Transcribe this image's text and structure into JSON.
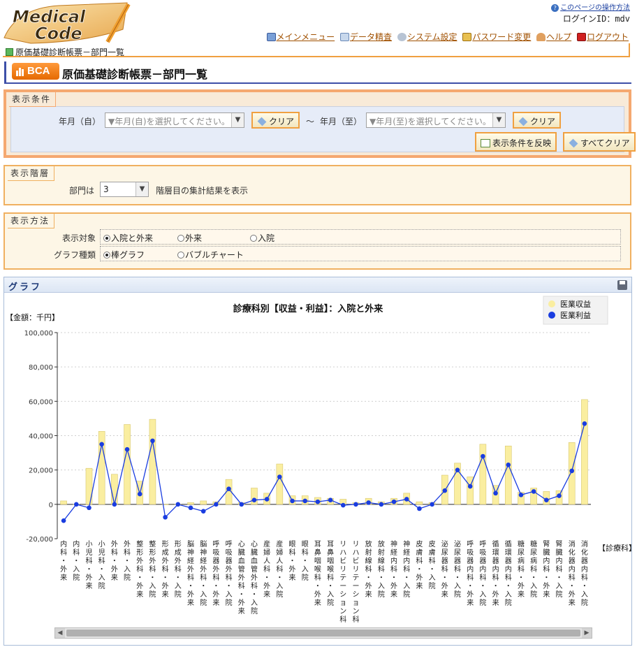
{
  "logo": {
    "line1": "Medical",
    "line2": "Code"
  },
  "header": {
    "help_link": "このページの操作方法",
    "login": "ログインID：mdv",
    "menu": [
      {
        "label": "メインメニュー",
        "icon": "menu-icon"
      },
      {
        "label": "データ精査",
        "icon": "data-icon"
      },
      {
        "label": "システム設定",
        "icon": "settings-icon"
      },
      {
        "label": "パスワード変更",
        "icon": "lock-icon"
      },
      {
        "label": "ヘルプ",
        "icon": "help-person-icon"
      },
      {
        "label": "ログアウト",
        "icon": "logout-icon"
      }
    ],
    "breadcrumb": "原価基礎診断帳票－部門一覧"
  },
  "title": {
    "badge": "BCA",
    "text": "原価基礎診断帳票－部門一覧"
  },
  "conditions": {
    "legend": "表示条件",
    "from_label": "年月（自）",
    "from_placeholder": "▼年月(自)を選択してください。",
    "clear1": "クリア",
    "tilde": "～",
    "to_label": "年月（至）",
    "to_placeholder": "▼年月(至)を選択してください。",
    "clear2": "クリア",
    "apply": "表示条件を反映",
    "clear_all": "すべてクリア"
  },
  "layer": {
    "legend": "表示階層",
    "prefix": "部門は",
    "value": "3",
    "suffix": "階層目の集計結果を表示"
  },
  "method": {
    "legend": "表示方法",
    "target_label": "表示対象",
    "targets": [
      "入院と外来",
      "外来",
      "入院"
    ],
    "target_selected": 0,
    "type_label": "グラフ種類",
    "types": [
      "棒グラフ",
      "バブルチャート"
    ],
    "type_selected": 0
  },
  "graph": {
    "header": "グラフ"
  },
  "chart_data": {
    "type": "bar",
    "title": "診療科別【収益・利益】：入院と外来",
    "ylabel": "【金額：千円】",
    "xlabel": "【診療科】",
    "ylim": [
      -20000,
      100000
    ],
    "yticks": [
      "100,000",
      "80,000",
      "60,000",
      "40,000",
      "20,000",
      "0",
      "-20,000"
    ],
    "grid": true,
    "legend_position": "top-right",
    "categories": [
      "内科・外来",
      "内科・入院",
      "小児科・外来",
      "小児科・入院",
      "外科・外来",
      "外科・入院",
      "整形外科・外来",
      "整形外科・入院",
      "形成外科・外来",
      "形成外科・入院",
      "脳神経外科・外来",
      "脳神経外科・入院",
      "呼吸器外科・外来",
      "呼吸器外科・入院",
      "心臓血管外科・外来",
      "心臓血管外科・入院",
      "産婦人科・外来",
      "産婦人科・入院",
      "眼科・外来",
      "眼科・入院",
      "耳鼻咽喉科・外来",
      "耳鼻咽喉科・入院",
      "リハビリテーション科",
      "リハビリテーション科",
      "放射線科・外来",
      "放射線科・入院",
      "神経内科・外来",
      "神経内科・入院",
      "皮膚科・外来",
      "皮膚科・入院",
      "泌尿器科・外来",
      "泌尿器科・入院",
      "呼吸器内科・外来",
      "呼吸器内科・入院",
      "循環器内科・外来",
      "循環器内科・入院",
      "糖尿病科・外来",
      "糖尿病科・入院",
      "腎臓内科・外来",
      "腎臓内科・入院",
      "消化器内科・外来",
      "消化器内科・入院"
    ],
    "series": [
      {
        "name": "医業収益",
        "color": "#faeea0",
        "values": [
          2000,
          0,
          21000,
          42500,
          17500,
          46500,
          13500,
          49500,
          0,
          0,
          1000,
          2000,
          1500,
          14500,
          1000,
          9500,
          6500,
          23500,
          5000,
          5000,
          4000,
          3500,
          3000,
          1000,
          3500,
          1500,
          3500,
          6500,
          1500,
          1000,
          17000,
          24000,
          16000,
          35000,
          11000,
          34000,
          7000,
          9500,
          7500,
          8000,
          36000,
          61000
        ]
      },
      {
        "name": "医業利益",
        "color": "#1a3de0",
        "values": [
          -9500,
          0,
          -2000,
          35000,
          0,
          32000,
          6000,
          37000,
          -7500,
          0,
          -2000,
          -4000,
          0,
          9000,
          0,
          2500,
          3000,
          16000,
          2000,
          2000,
          1500,
          2500,
          -500,
          0,
          1000,
          0,
          1500,
          3000,
          -2500,
          0,
          8000,
          20000,
          10500,
          28000,
          6500,
          23000,
          5500,
          7500,
          2500,
          5000,
          19500,
          47000
        ]
      }
    ]
  }
}
